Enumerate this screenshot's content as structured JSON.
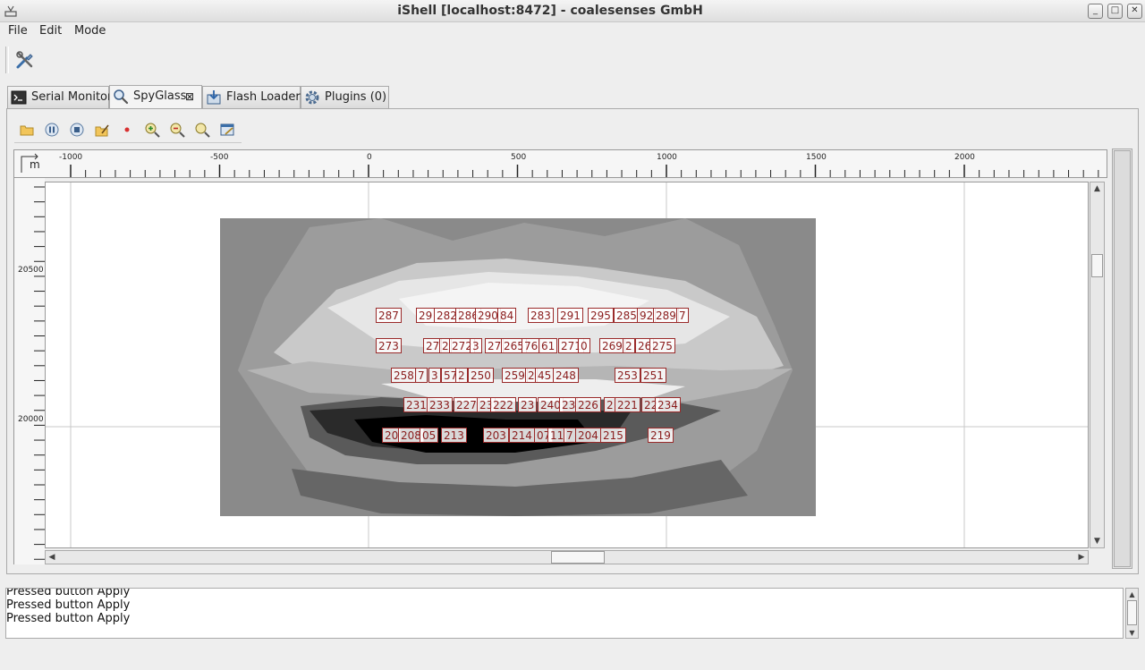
{
  "window": {
    "title": "iShell [localhost:8472] - coalesenses GmbH",
    "controls": [
      "minimize",
      "maximize",
      "close"
    ]
  },
  "menu": [
    {
      "label": "File"
    },
    {
      "label": "Edit"
    },
    {
      "label": "Mode"
    }
  ],
  "tabs": [
    {
      "label": "Serial Monitor",
      "icon": "terminal-icon"
    },
    {
      "label": "SpyGlass",
      "icon": "magnifier-icon",
      "active": true,
      "closable": true
    },
    {
      "label": "Flash Loader",
      "icon": "flash-icon"
    },
    {
      "label": "Plugins (0)",
      "icon": "gear-icon"
    }
  ],
  "spyglass_toolbar": [
    "open-folder-icon",
    "pause-icon",
    "stop-icon",
    "edit-folder-icon",
    "record-dot-icon",
    "zoom-in-icon",
    "zoom-out-icon",
    "zoom-reset-icon",
    "settings-icon"
  ],
  "ruler": {
    "unit": "m",
    "x_labels": [
      "-1000",
      "-500",
      "0",
      "500",
      "1000",
      "1500",
      "2000"
    ],
    "y_labels": [
      "20500",
      "20000"
    ]
  },
  "node_labels": {
    "row1": [
      "287",
      "29",
      "282",
      "286",
      "290",
      "84",
      "283",
      "291",
      "295",
      "285",
      "92",
      "289",
      "7"
    ],
    "row2": [
      "273",
      "27",
      "2",
      "272",
      "3",
      "27",
      "265",
      "76",
      "61",
      "271",
      "0",
      "269",
      "2",
      "26",
      "275"
    ],
    "row3": [
      "258",
      "7",
      "3",
      "57",
      "2",
      "250",
      "259",
      "2",
      "45",
      "248",
      "253",
      "251"
    ],
    "row4": [
      "231",
      "233",
      "227",
      "23",
      "222",
      "23",
      "240",
      "23",
      "226",
      "2",
      "221",
      "22",
      "234"
    ],
    "row5": [
      "20",
      "208",
      "05",
      "213",
      "203",
      "214",
      "07",
      "11",
      "7",
      "204",
      "215",
      "219"
    ]
  },
  "log": {
    "lines": [
      "Pressed button Apply",
      "Pressed button Apply",
      "Pressed button Apply"
    ]
  },
  "colors": {
    "label_border": "#9a2a2a",
    "label_text": "#8a1c1c"
  }
}
